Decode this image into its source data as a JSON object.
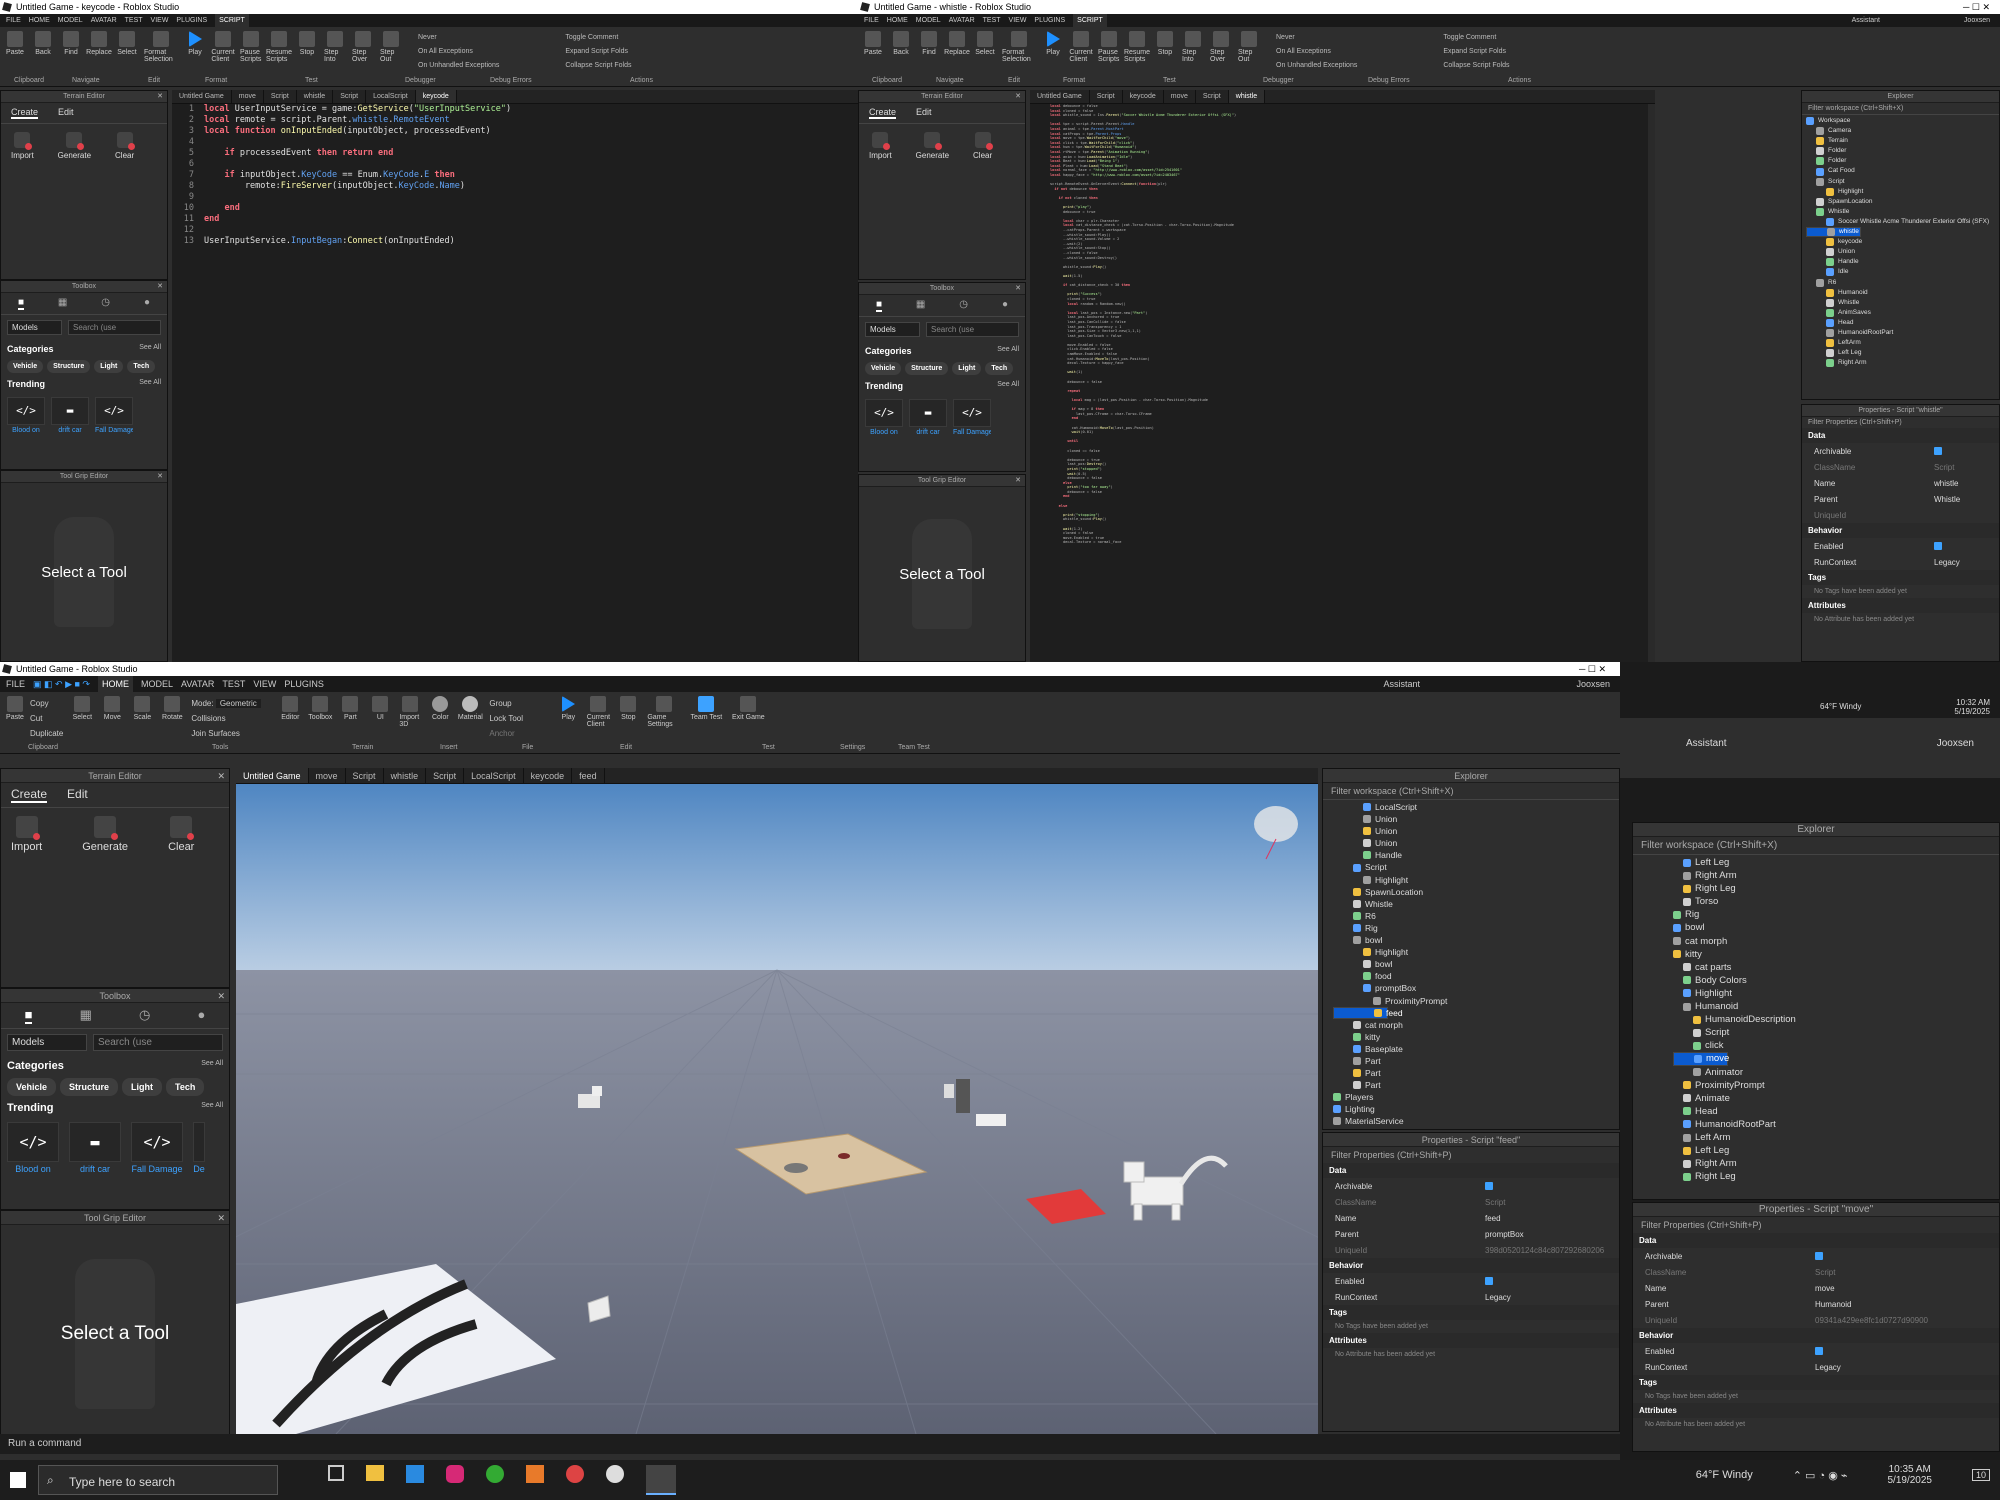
{
  "screen1": {
    "title": "Untitled Game - keycode - Roblox Studio"
  },
  "screen2": {
    "title": "Untitled Game - whistle - Roblox Studio"
  },
  "screen3": {
    "title": "Untitled Game - Roblox Studio"
  },
  "menu": [
    "FILE",
    "HOME",
    "MODEL",
    "AVATAR",
    "TEST",
    "VIEW",
    "PLUGINS",
    "SCRIPT"
  ],
  "script_ribbon": {
    "buttons": [
      "Paste",
      "Back",
      "Find",
      "Replace",
      "Select",
      "Format Selection",
      "Play",
      "Current Client",
      "Pause Scripts",
      "Resume Scripts",
      "Stop",
      "Step Into",
      "Step Over",
      "Step Out"
    ],
    "groups": [
      "Clipboard",
      "Navigate",
      "Edit",
      "Format",
      "Test",
      "Debugger",
      "Debug Errors",
      "Actions"
    ],
    "debug_opts": [
      "Never",
      "On All Exceptions",
      "On Unhandled Exceptions"
    ],
    "actions": [
      "Toggle Comment",
      "Expand Script Folds",
      "Collapse Script Folds"
    ]
  },
  "home_ribbon": {
    "buttons": [
      "Paste",
      "Copy",
      "Cut",
      "Duplicate",
      "Select",
      "Move",
      "Scale",
      "Rotate",
      "Editor",
      "Toolbox",
      "Part",
      "UI",
      "Import 3D",
      "Color",
      "Material",
      "Play",
      "Current Client",
      "Stop",
      "Game Settings",
      "Team Test",
      "Exit Game"
    ],
    "mode_label": "Mode:",
    "mode_value": "Geometric",
    "toggles": [
      "Collisions",
      "Join Surfaces"
    ],
    "group_ops": [
      "Group",
      "Lock Tool",
      "Anchor"
    ],
    "groups": [
      "Clipboard",
      "Tools",
      "Terrain",
      "Insert",
      "File",
      "Edit",
      "Test",
      "Settings",
      "Team Test"
    ]
  },
  "terrain": {
    "title": "Terrain Editor",
    "tabs": [
      "Create",
      "Edit"
    ],
    "buttons": [
      "Import",
      "Generate",
      "Clear"
    ]
  },
  "toolbox": {
    "title": "Toolbox",
    "dropdown": "Models",
    "search_placeholder": "Search (use",
    "categories_label": "Categories",
    "see_all": "See All",
    "chips": [
      "Vehicle",
      "Structure",
      "Light",
      "Tech"
    ],
    "trending_label": "Trending",
    "items": [
      "Blood on",
      "drift car",
      "Fall Damage",
      "De"
    ]
  },
  "toolgrip": {
    "title": "Tool Grip Editor",
    "message": "Select a Tool"
  },
  "tabs1": [
    "Untitled Game",
    "move",
    "Script",
    "whistle",
    "Script",
    "LocalScript",
    "keycode"
  ],
  "tabs2": [
    "Untitled Game",
    "Script",
    "keycode",
    "move",
    "Script",
    "whistle"
  ],
  "tabs3": [
    "Untitled Game",
    "move",
    "Script",
    "whistle",
    "Script",
    "LocalScript",
    "keycode",
    "feed"
  ],
  "code1": {
    "lines": [
      "1",
      "2",
      "3",
      "4",
      "5",
      "6",
      "7",
      "8",
      "9",
      "10",
      "11",
      "12",
      "13"
    ]
  },
  "explorer2": {
    "title": "Explorer",
    "filter": "Filter workspace (Ctrl+Shift+X)",
    "items": [
      "Workspace",
      "Camera",
      "Terrain",
      "Folder",
      "Folder",
      "Cat Food",
      "Script",
      "Highlight",
      "SpawnLocation",
      "Whistle",
      "Soccer Whistle Acme Thunderer Exterior Offsi (SFX)",
      "whistle",
      "keycode",
      "Union",
      "Handle",
      "Idle",
      "R6",
      "Humanoid",
      "Whistle",
      "AnimSaves",
      "Head",
      "HumanoidRootPart",
      "LeftArm",
      "Left Leg",
      "Right Arm"
    ]
  },
  "explorer3": {
    "title": "Explorer",
    "filter": "Filter workspace (Ctrl+Shift+X)",
    "items": [
      "LocalScript",
      "Union",
      "Union",
      "Union",
      "Handle",
      "Script",
      "Highlight",
      "SpawnLocation",
      "Whistle",
      "R6",
      "Rig",
      "bowl",
      "Highlight",
      "bowl",
      "food",
      "promptBox",
      "ProximityPrompt",
      "feed",
      "cat morph",
      "kitty",
      "Baseplate",
      "Part",
      "Part",
      "Part",
      "Players",
      "Lighting",
      "MaterialService"
    ]
  },
  "explorer4": {
    "title": "Explorer",
    "filter": "Filter workspace (Ctrl+Shift+X)",
    "items": [
      "Left Leg",
      "Right Arm",
      "Right Leg",
      "Torso",
      "Rig",
      "bowl",
      "cat morph",
      "kitty",
      "cat parts",
      "Body Colors",
      "Highlight",
      "Humanoid",
      "HumanoidDescription",
      "Script",
      "click",
      "move",
      "Animator",
      "ProximityPrompt",
      "Animate",
      "Head",
      "HumanoidRootPart",
      "Left Arm",
      "Left Leg",
      "Right Arm",
      "Right Leg"
    ]
  },
  "props2": {
    "title": "Properties - Script \"whistle\"",
    "filter": "Filter Properties (Ctrl+Shift+P)",
    "name": "whistle",
    "parent": "Whistle",
    "runcontext": "Legacy"
  },
  "props3": {
    "title": "Properties - Script \"feed\"",
    "filter": "Filter Properties (Ctrl+Shift+P)",
    "name": "feed",
    "parent": "promptBox",
    "runcontext": "Legacy",
    "uniqueid": "398d0520124c84c807292680206"
  },
  "props4": {
    "title": "Properties - Script \"move\"",
    "filter": "Filter Properties (Ctrl+Shift+P)",
    "name": "move",
    "parent": "Humanoid",
    "runcontext": "Legacy",
    "uniqueid": "09341a429ee8fc1d0727d90900"
  },
  "props_labels": {
    "data": "Data",
    "archivable": "Archivable",
    "classname": "ClassName",
    "classval": "Script",
    "name": "Name",
    "parent": "Parent",
    "uniqueid": "UniqueId",
    "behavior": "Behavior",
    "enabled": "Enabled",
    "runcontext": "RunContext",
    "tags": "Tags",
    "tags_note": "No Tags have been added yet",
    "attributes": "Attributes",
    "attr_note": "No Attribute has been added yet"
  },
  "command_bar": "Run a command",
  "user": {
    "assistant": "Assistant",
    "name": "Jooxsen"
  },
  "tray1": {
    "weather": "64°F Windy",
    "time": "10:32 AM",
    "date": "5/19/2025"
  },
  "tray2": {
    "weather": "64°F Windy",
    "time": "10:35 AM",
    "date": "5/19/2025",
    "badge": "10"
  },
  "taskbar": {
    "search": "Type here to search"
  }
}
